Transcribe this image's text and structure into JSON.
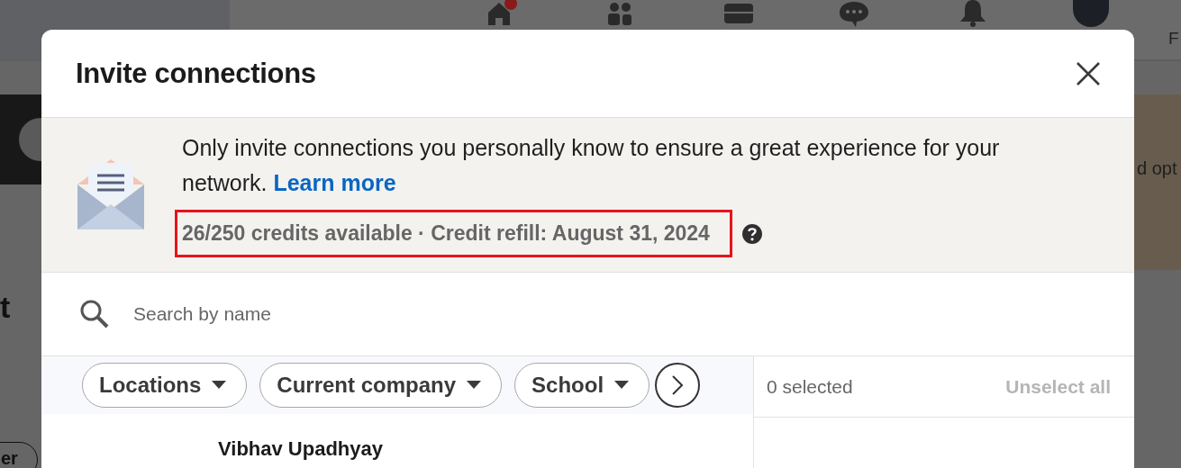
{
  "background": {
    "nav_badge": true,
    "top_right_text": "F",
    "right_text": "d opt",
    "left_text": "t",
    "left_button": "er"
  },
  "dialog": {
    "title": "Invite connections",
    "notice": {
      "text": "Only invite connections you personally know to ensure a great experience for your network.",
      "link": "Learn more",
      "credits": "26/250 credits available · Credit refill: August 31, 2024",
      "highlighted": true
    },
    "search": {
      "placeholder": "Search by name"
    },
    "filters": [
      {
        "label": "Locations"
      },
      {
        "label": "Current company"
      },
      {
        "label": "School"
      }
    ],
    "selection": {
      "count": "0 selected",
      "unselect": "Unselect all",
      "unselect_disabled": true
    },
    "people": [
      {
        "name": "Vibhav Upadhyay"
      }
    ]
  }
}
